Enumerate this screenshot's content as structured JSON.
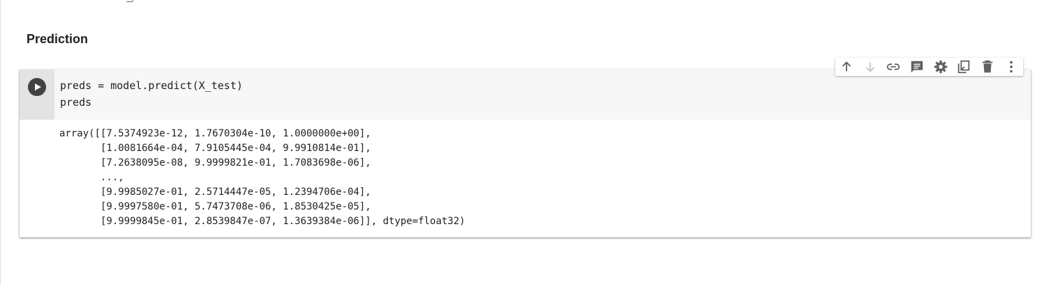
{
  "section": {
    "heading": "Prediction"
  },
  "cell": {
    "code_lines": [
      "preds = model.predict(X_test)",
      "preds"
    ],
    "output_lines": [
      "array([[7.5374923e-12, 1.7670304e-10, 1.0000000e+00],",
      "       [1.0081664e-04, 7.9105445e-04, 9.9910814e-01],",
      "       [7.2638095e-08, 9.9999821e-01, 1.7083698e-06],",
      "       ...,",
      "       [9.9985027e-01, 2.5714447e-05, 1.2394706e-04],",
      "       [9.9997580e-01, 5.7473708e-06, 1.8530425e-05],",
      "       [9.9999845e-01, 2.8539847e-07, 1.3639384e-06]], dtype=float32)"
    ]
  },
  "toolbar": {
    "icons": [
      "arrow-up-icon",
      "arrow-down-icon",
      "link-icon",
      "comment-icon",
      "gear-icon",
      "mirror-cell-icon",
      "trash-icon",
      "more-vert-icon"
    ]
  },
  "colors": {
    "gutter": "#e3e3e3",
    "editor_bg": "#f7f7f7",
    "run_button": "#424242",
    "icon": "#616161",
    "icon_disabled": "#c4c4c4"
  }
}
